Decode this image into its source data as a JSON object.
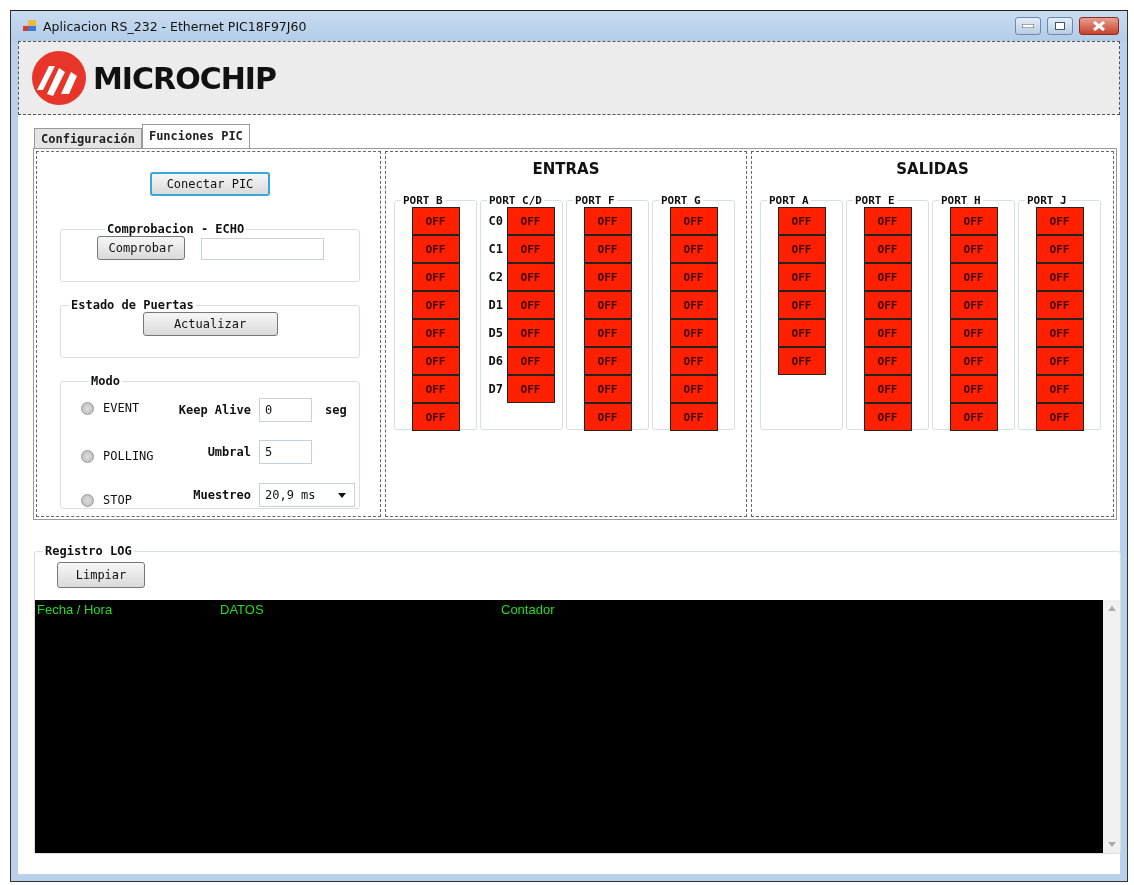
{
  "window": {
    "title": "Aplicacion RS_232 - Ethernet PIC18F97J60"
  },
  "logo": {
    "text": "MICROCHIP"
  },
  "tabs": [
    {
      "label": "Configuración",
      "selected": false
    },
    {
      "label": "Funciones PIC",
      "selected": true
    }
  ],
  "connect_button": "Conectar PIC",
  "echo_group": {
    "title": "Comprobacion - ECHO",
    "button": "Comprobar"
  },
  "doors_group": {
    "title": "Estado de Puertas",
    "button": "Actualizar"
  },
  "mode_group": {
    "title": "Modo",
    "options": [
      {
        "label": "EVENT",
        "selected": false
      },
      {
        "label": "POLLING",
        "selected": false
      },
      {
        "label": "STOP",
        "selected": false
      }
    ],
    "keep_alive": {
      "label": "Keep Alive",
      "value": "0",
      "unit": "seg"
    },
    "threshold": {
      "label": "Umbral",
      "value": "5"
    },
    "sampling": {
      "label": "Muestreo",
      "value": "20,9 ms"
    }
  },
  "inputs": {
    "title": "ENTRAS",
    "ports": [
      {
        "name": "PORT B",
        "bits": [
          {
            "state": "OFF",
            "on": false
          },
          {
            "state": "OFF",
            "on": false
          },
          {
            "state": "OFF",
            "on": false
          },
          {
            "state": "OFF",
            "on": false
          },
          {
            "state": "OFF",
            "on": false
          },
          {
            "state": "OFF",
            "on": false
          },
          {
            "state": "OFF",
            "on": false
          },
          {
            "state": "OFF",
            "on": false
          }
        ]
      },
      {
        "name": "PORT C/D",
        "bits": [
          {
            "pin": "C0",
            "state": "OFF",
            "on": false
          },
          {
            "pin": "C1",
            "state": "OFF",
            "on": false
          },
          {
            "pin": "C2",
            "state": "OFF",
            "on": false
          },
          {
            "pin": "D1",
            "state": "OFF",
            "on": false
          },
          {
            "pin": "D5",
            "state": "OFF",
            "on": false
          },
          {
            "pin": "D6",
            "state": "OFF",
            "on": false
          },
          {
            "pin": "D7",
            "state": "OFF",
            "on": false
          }
        ]
      },
      {
        "name": "PORT F",
        "bits": [
          {
            "state": "OFF",
            "on": false
          },
          {
            "state": "OFF",
            "on": false
          },
          {
            "state": "OFF",
            "on": false
          },
          {
            "state": "OFF",
            "on": false
          },
          {
            "state": "OFF",
            "on": false
          },
          {
            "state": "OFF",
            "on": false
          },
          {
            "state": "OFF",
            "on": false
          },
          {
            "state": "OFF",
            "on": false
          }
        ]
      },
      {
        "name": "PORT G",
        "bits": [
          {
            "state": "OFF",
            "on": false
          },
          {
            "state": "OFF",
            "on": false
          },
          {
            "state": "OFF",
            "on": false
          },
          {
            "state": "OFF",
            "on": false
          },
          {
            "state": "OFF",
            "on": false
          },
          {
            "state": "OFF",
            "on": false
          },
          {
            "state": "OFF",
            "on": false
          },
          {
            "state": "OFF",
            "on": false
          }
        ]
      }
    ]
  },
  "outputs": {
    "title": "SALIDAS",
    "ports": [
      {
        "name": "PORT A",
        "bits": [
          {
            "state": "OFF",
            "on": false
          },
          {
            "state": "OFF",
            "on": false
          },
          {
            "state": "OFF",
            "on": false
          },
          {
            "state": "OFF",
            "on": false
          },
          {
            "state": "OFF",
            "on": false
          },
          {
            "state": "OFF",
            "on": false
          }
        ]
      },
      {
        "name": "PORT E",
        "bits": [
          {
            "state": "OFF",
            "on": false
          },
          {
            "state": "OFF",
            "on": false
          },
          {
            "state": "OFF",
            "on": false
          },
          {
            "state": "OFF",
            "on": false
          },
          {
            "state": "OFF",
            "on": false
          },
          {
            "state": "OFF",
            "on": false
          },
          {
            "state": "OFF",
            "on": false
          },
          {
            "state": "OFF",
            "on": false
          }
        ]
      },
      {
        "name": "PORT H",
        "bits": [
          {
            "state": "OFF",
            "on": false
          },
          {
            "state": "OFF",
            "on": false
          },
          {
            "state": "OFF",
            "on": false
          },
          {
            "state": "OFF",
            "on": false
          },
          {
            "state": "OFF",
            "on": false
          },
          {
            "state": "OFF",
            "on": false
          },
          {
            "state": "OFF",
            "on": false
          },
          {
            "state": "OFF",
            "on": false
          }
        ]
      },
      {
        "name": "PORT J",
        "bits": [
          {
            "state": "OFF",
            "on": false
          },
          {
            "state": "OFF",
            "on": false
          },
          {
            "state": "OFF",
            "on": false
          },
          {
            "state": "OFF",
            "on": false
          },
          {
            "state": "OFF",
            "on": false
          },
          {
            "state": "OFF",
            "on": false
          },
          {
            "state": "OFF",
            "on": false
          },
          {
            "state": "OFF",
            "on": false
          }
        ]
      }
    ]
  },
  "log": {
    "title": "Registro LOG",
    "button": "Limpiar",
    "columns": [
      "Fecha / Hora",
      "DATOS",
      "Contador"
    ]
  }
}
